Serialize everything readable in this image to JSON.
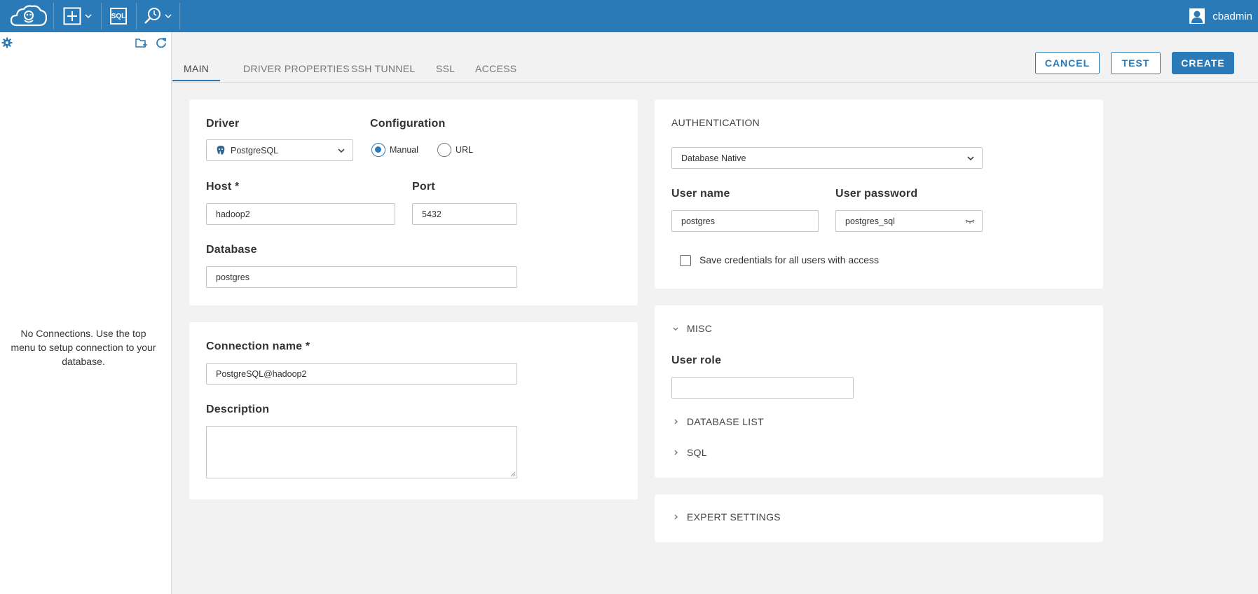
{
  "topbar": {
    "user_name": "cbadmin",
    "sql_label": "SQL"
  },
  "sidebar": {
    "empty_message": "No Connections. Use the top menu to setup connection to your database."
  },
  "tabs": [
    {
      "label": "MAIN",
      "active": true
    },
    {
      "label": "DRIVER PROPERTIES",
      "active": false
    },
    {
      "label": "SSH TUNNEL",
      "active": false
    },
    {
      "label": "SSL",
      "active": false
    },
    {
      "label": "ACCESS",
      "active": false
    }
  ],
  "actions": {
    "cancel": "CANCEL",
    "test": "TEST",
    "create": "CREATE"
  },
  "main": {
    "driver_label": "Driver",
    "driver_value": "PostgreSQL",
    "configuration_label": "Configuration",
    "config_manual": "Manual",
    "config_url": "URL",
    "config_selected": "Manual",
    "host_label": "Host *",
    "host_value": "hadoop2",
    "port_label": "Port",
    "port_value": "5432",
    "database_label": "Database",
    "database_value": "postgres",
    "connection_name_label": "Connection name *",
    "connection_name_value": "PostgreSQL@hadoop2",
    "description_label": "Description",
    "description_value": ""
  },
  "auth": {
    "title": "AUTHENTICATION",
    "method": "Database Native",
    "username_label": "User name",
    "username_value": "postgres",
    "password_label": "User password",
    "password_value": "postgres_sql",
    "save_credentials_label": "Save credentials for all users with access",
    "save_credentials_checked": false
  },
  "misc": {
    "title": "MISC",
    "user_role_label": "User role",
    "user_role_value": "",
    "database_list": "DATABASE LIST",
    "sql": "SQL"
  },
  "expert": {
    "title": "EXPERT SETTINGS"
  },
  "colors": {
    "accent": "#2a7ab8",
    "background": "#f2f2f2",
    "card": "#ffffff"
  }
}
